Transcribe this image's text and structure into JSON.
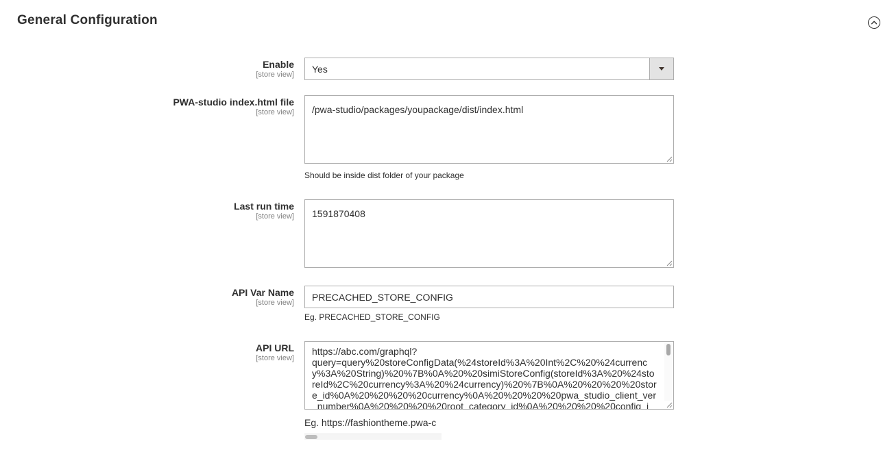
{
  "section": {
    "title": "General Configuration"
  },
  "fields": {
    "enable": {
      "label": "Enable",
      "scope": "[store view]",
      "value": "Yes"
    },
    "index_file": {
      "label": "PWA-studio index.html file",
      "scope": "[store view]",
      "value": "/pwa-studio/packages/youpackage/dist/index.html",
      "note": "Should be inside dist folder of your package"
    },
    "last_run": {
      "label": "Last run time",
      "scope": "[store view]",
      "value": "1591870408"
    },
    "api_var": {
      "label": "API Var Name",
      "scope": "[store view]",
      "value": "PRECACHED_STORE_CONFIG",
      "note": "Eg. PRECACHED_STORE_CONFIG"
    },
    "api_url": {
      "label": "API URL",
      "scope": "[store view]",
      "value": "https://abc.com/graphql?\nquery=query%20storeConfigData(%24storeId%3A%20Int%2C%20%24currency%3A%20String)%20%7B%0A%20%20simiStoreConfig(storeId%3A%20%24storeId%2C%20currency%3A%20%24currency)%20%7B%0A%20%20%20%20store_id%0A%20%20%20%20currency%0A%20%20%20%20pwa_studio_client_ver_number%0A%20%20%20%20root_category_id%0A%20%20%20%20config_i",
      "note": "Eg. https://fashiontheme.pwa-c"
    }
  }
}
